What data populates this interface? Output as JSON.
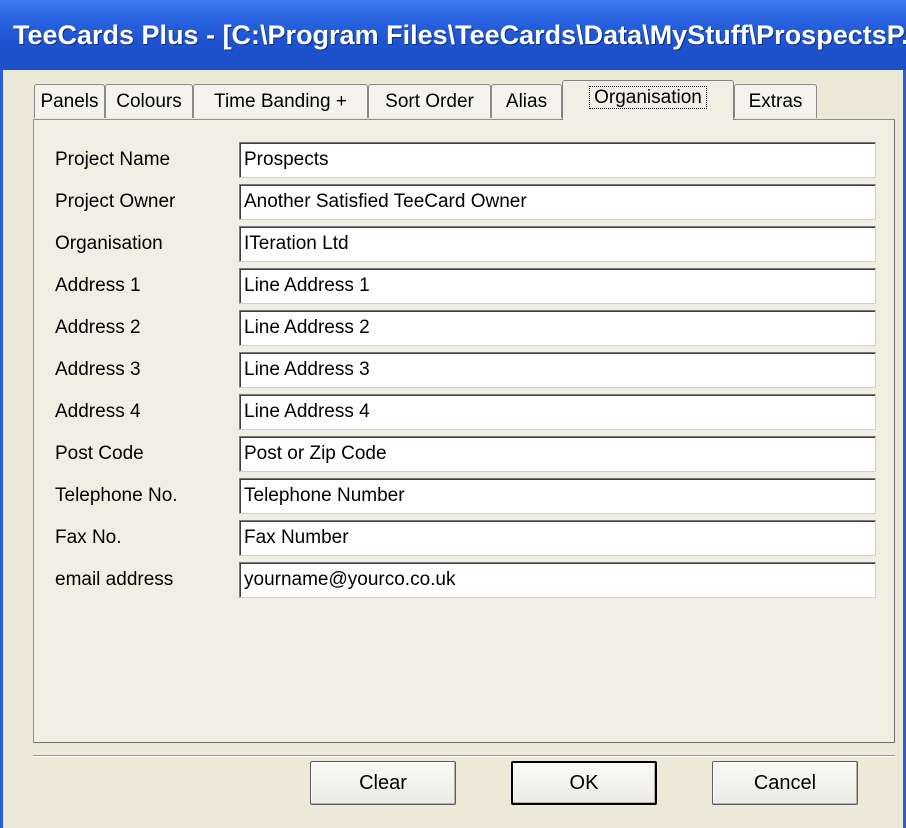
{
  "window": {
    "title": "TeeCards Plus - [C:\\Program Files\\TeeCards\\Data\\MyStuff\\ProspectsP..."
  },
  "tabs": [
    {
      "label": "Panels",
      "active": false
    },
    {
      "label": "Colours",
      "active": false
    },
    {
      "label": "Time Banding +",
      "active": false
    },
    {
      "label": "Sort Order",
      "active": false
    },
    {
      "label": "Alias",
      "active": false
    },
    {
      "label": "Organisation",
      "active": true
    },
    {
      "label": "Extras",
      "active": false
    }
  ],
  "form": {
    "fields": [
      {
        "label": "Project Name",
        "value": "Prospects"
      },
      {
        "label": "Project Owner",
        "value": "Another Satisfied TeeCard Owner"
      },
      {
        "label": "Organisation",
        "value": "ITeration Ltd"
      },
      {
        "label": "Address 1",
        "value": "Line Address 1"
      },
      {
        "label": "Address 2",
        "value": "Line Address 2"
      },
      {
        "label": "Address 3",
        "value": "Line Address 3"
      },
      {
        "label": "Address 4",
        "value": "Line Address 4"
      },
      {
        "label": "Post Code",
        "value": "Post or Zip Code"
      },
      {
        "label": "Telephone No.",
        "value": "Telephone Number"
      },
      {
        "label": "Fax No.",
        "value": "Fax Number"
      },
      {
        "label": "email address",
        "value": "yourname@yourco.co.uk"
      }
    ]
  },
  "buttons": {
    "clear": "Clear",
    "ok": "OK",
    "cancel": "Cancel"
  },
  "colors": {
    "titlebar": "#1e53d0",
    "dialog_bg": "#ece9d8",
    "panel_bg": "#f1efe4"
  }
}
